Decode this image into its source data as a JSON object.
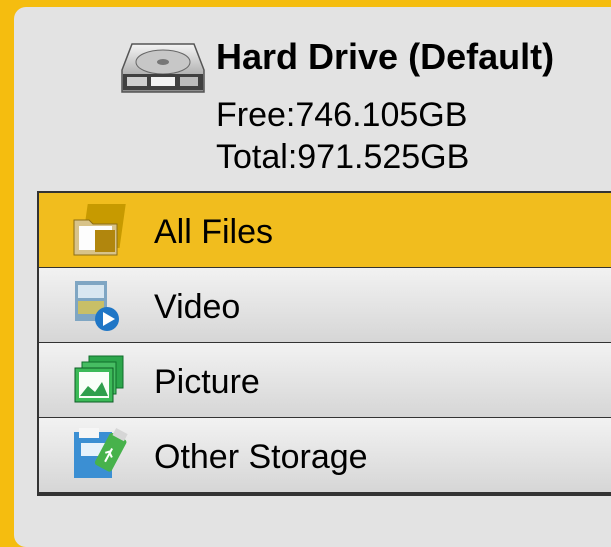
{
  "drive": {
    "icon": "hard-drive-icon",
    "title": "Hard Drive (Default)",
    "free": "Free:746.105GB",
    "total": "Total:971.525GB"
  },
  "menu": {
    "selected_index": 0,
    "items": [
      {
        "label": "All Files",
        "icon": "folder-icon"
      },
      {
        "label": "Video",
        "icon": "video-icon"
      },
      {
        "label": "Picture",
        "icon": "picture-icon"
      },
      {
        "label": "Other Storage",
        "icon": "storage-icon"
      }
    ]
  },
  "colors": {
    "background": "#f5bd0f",
    "panel": "#e3e3e3",
    "selected": "#f1bd1e"
  }
}
